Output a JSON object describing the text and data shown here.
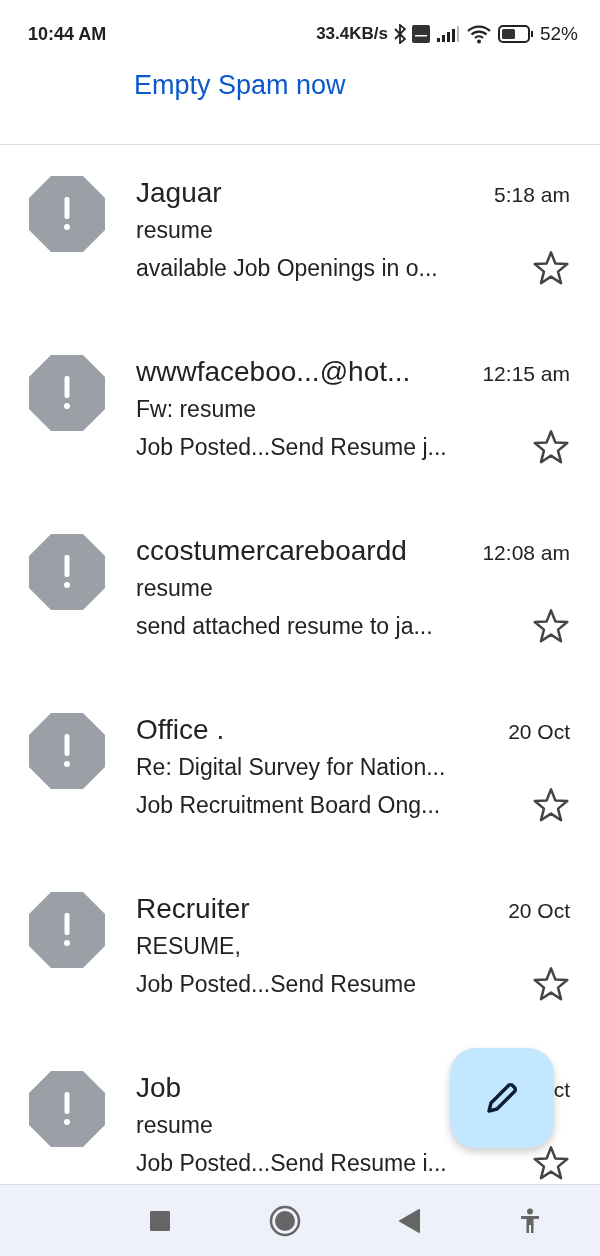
{
  "status_bar": {
    "time": "10:44 AM",
    "speed": "33.4KB/s",
    "battery": "52%"
  },
  "header": {
    "action": "Empty Spam now"
  },
  "messages": [
    {
      "sender": "Jaguar",
      "time": "5:18 am",
      "subject": "resume",
      "snippet": "available Job Openings in o...",
      "starred": false
    },
    {
      "sender": "wwwfaceboo...@hot...",
      "time": "12:15 am",
      "subject": "Fw: resume",
      "snippet": "Job Posted...Send Resume j...",
      "starred": false
    },
    {
      "sender": "ccostumercareboardd",
      "time": "12:08 am",
      "subject": "resume",
      "snippet": "send attached resume to ja...",
      "starred": false
    },
    {
      "sender": "Office .",
      "time": "20 Oct",
      "subject": "Re: Digital Survey for Nation...",
      "snippet": "Job Recruitment Board Ong...",
      "starred": false
    },
    {
      "sender": "Recruiter",
      "time": "20 Oct",
      "subject": "RESUME,",
      "snippet": "Job Posted...Send Resume",
      "starred": false
    },
    {
      "sender": "Job",
      "time": "ct",
      "subject": "resume",
      "snippet": "Job Posted...Send Resume i...",
      "starred": false
    }
  ]
}
